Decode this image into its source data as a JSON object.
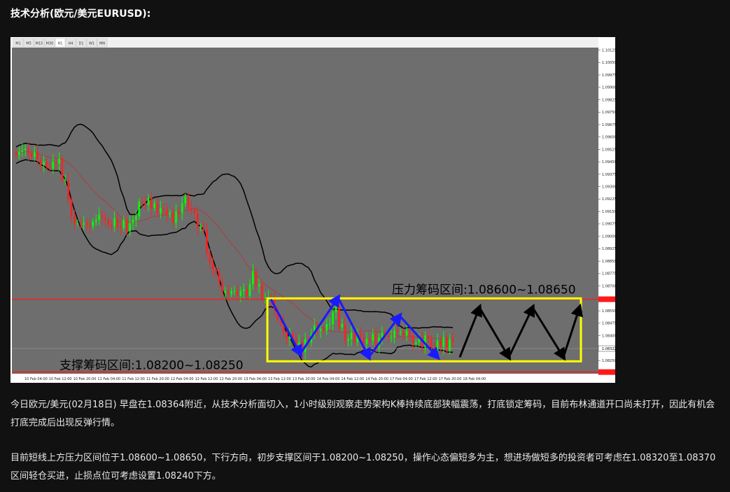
{
  "page": {
    "title": "技术分析(欧元/美元EURUSD):",
    "paragraphs": [
      "今日欧元/美元(02月18日) 早盘在1.08364附近，从技术分析面切入，1小时级别观察走势架构K棒持续底部狭幅震荡，打底锁定筹码，目前布林通道开口尚未打开，因此有机会打底完成后出现反弹行情。",
      "目前短线上方压力区间位于1.08600~1.08650，下行方向，初步支撑区间于1.08200~1.08250，操作心态偏短多为主，想进场做短多的投资者可考虑在1.08320至1.08370区间轻仓买进，止损点位可考虑设置1.08240下方。"
    ]
  },
  "chart_data": {
    "type": "candlestick",
    "symbol": "EURUSD",
    "timeframe_tabs": [
      "M1",
      "M5",
      "M15",
      "M30",
      "H1",
      "H4",
      "D1",
      "W1",
      "MN"
    ],
    "active_tab": "H1",
    "ylim": [
      1.0817,
      1.1014
    ],
    "y_ticks": [
      "1.10125",
      "1.10050",
      "1.09975",
      "1.09900",
      "1.09825",
      "1.09750",
      "1.09675",
      "1.09600",
      "1.09525",
      "1.09450",
      "1.09375",
      "1.09300",
      "1.09225",
      "1.09150",
      "1.09075",
      "1.09000",
      "1.08925",
      "1.08850",
      "1.08775",
      "1.08700",
      "1.08625",
      "1.08550",
      "1.08475",
      "1.08400",
      "1.08325",
      "1.08250",
      "1.08175"
    ],
    "x_ticks": [
      "10 Feb 04:00",
      "10 Feb 12:00",
      "10 Feb 20:00",
      "11 Feb 04:00",
      "11 Feb 12:00",
      "11 Feb 20:00",
      "12 Feb 04:00",
      "12 Feb 12:00",
      "12 Feb 20:00",
      "13 Feb 04:00",
      "13 Feb 12:00",
      "13 Feb 20:00",
      "14 Feb 04:00",
      "14 Feb 12:00",
      "14 Feb 20:00",
      "17 Feb 04:00",
      "17 Feb 12:00",
      "17 Feb 20:00",
      "18 Feb 04:00"
    ],
    "current_price": "1.08322",
    "resistance_level": 1.0862,
    "support_level": 1.0818,
    "resistance_label": "压力筹码区间:1.08600~1.08650",
    "support_label": "支撑筹码区间:1.08200~1.08250",
    "colors": {
      "background": "#6e6e6e",
      "bull": "#00ff00",
      "bear": "#ff2020",
      "level_line": "#ff1a1a",
      "box": "#ffff00",
      "blue_arrow": "#1a1aff",
      "black_arrow": "#000000",
      "band": "#000000",
      "mid_band": "#c03030"
    },
    "closes": [
      1.0949,
      1.0951,
      1.0952,
      1.0953,
      1.095,
      1.0948,
      1.0951,
      1.0946,
      1.0943,
      1.0945,
      1.0942,
      1.0941,
      1.0945,
      1.0944,
      1.0947,
      1.0934,
      1.0934,
      1.0922,
      1.0912,
      1.0908,
      1.0908,
      1.0907,
      1.0908,
      1.0907,
      1.0906,
      1.0909,
      1.091,
      1.0913,
      1.0911,
      1.091,
      1.0907,
      1.0906,
      1.0911,
      1.0906,
      1.0905,
      1.091,
      1.0903,
      1.0908,
      1.091,
      1.0912,
      1.0921,
      1.092,
      1.0919,
      1.0923,
      1.0917,
      1.092,
      1.0914,
      1.0917,
      1.0916,
      1.0913,
      1.0914,
      1.0908,
      1.0915,
      1.0914,
      1.092,
      1.0924,
      1.0917,
      1.0916,
      1.0914,
      1.0905,
      1.0906,
      1.0904,
      1.089,
      1.0884,
      1.088,
      1.0878,
      1.0872,
      1.0866,
      1.0867,
      1.0865,
      1.0867,
      1.0867,
      1.0864,
      1.0867,
      1.0868,
      1.0864,
      1.0871,
      1.0879,
      1.087,
      1.0871,
      1.0862,
      1.0863,
      1.0863,
      1.0862,
      1.0856,
      1.085,
      1.0848,
      1.0842,
      1.0838,
      1.0841,
      1.0838,
      1.0832,
      1.0836,
      1.083,
      1.0838,
      1.0836,
      1.0841,
      1.0846,
      1.0843,
      1.0844,
      1.0843,
      1.0847,
      1.0847,
      1.0854,
      1.0858,
      1.0845,
      1.0847,
      1.0837,
      1.0838,
      1.0842,
      1.0836,
      1.0841,
      1.0839,
      1.0835,
      1.0838,
      1.0837,
      1.0841,
      1.0833,
      1.0839,
      1.0842,
      1.084,
      1.0839,
      1.0839,
      1.0843,
      1.0842,
      1.0842,
      1.084,
      1.0843,
      1.084,
      1.0835,
      1.0836,
      1.0838,
      1.0833,
      1.084,
      1.0838,
      1.0833,
      1.0831,
      1.0837,
      1.0833,
      1.0839,
      1.0831,
      1.0838,
      1.0836
    ],
    "blue_zigzag_prices": [
      1.0862,
      1.0829,
      1.0863,
      1.0827,
      1.0852,
      1.0827
    ],
    "black_zigzag_prices": [
      1.0827,
      1.0857,
      1.0827,
      1.0857,
      1.0827,
      1.0857
    ]
  }
}
